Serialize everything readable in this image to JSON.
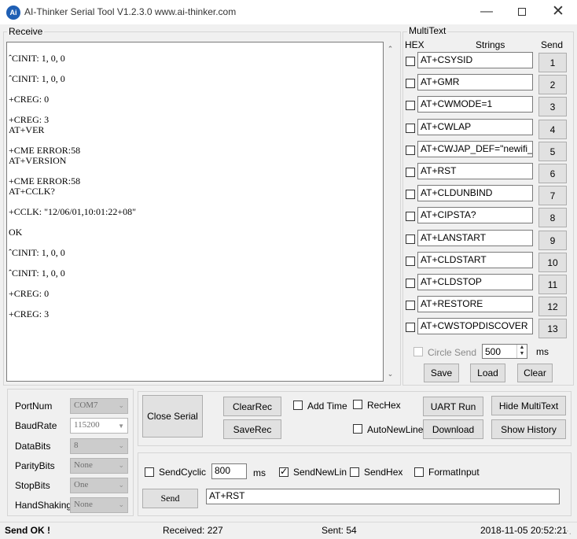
{
  "window": {
    "title": "AI-Thinker Serial Tool V1.2.3.0    www.ai-thinker.com",
    "icon_text": "Ai"
  },
  "receive": {
    "label": "Receive",
    "lines": "ˆCINIT: 1, 0, 0\n\nˆCINIT: 1, 0, 0\n\n+CREG: 0\n\n+CREG: 3\nAT+VER\n\n+CME ERROR:58\nAT+VERSION\n\n+CME ERROR:58\nAT+CCLK?\n\n+CCLK: \"12/06/01,10:01:22+08\"\n\nOK\n\nˆCINIT: 1, 0, 0\n\nˆCINIT: 1, 0, 0\n\n+CREG: 0\n\n+CREG: 3"
  },
  "multitext": {
    "label": "MultiText",
    "hdr_hex": "HEX",
    "hdr_strings": "Strings",
    "hdr_send": "Send",
    "rows": [
      {
        "text": "AT+CSYSID",
        "btn": "1"
      },
      {
        "text": "AT+GMR",
        "btn": "2"
      },
      {
        "text": "AT+CWMODE=1",
        "btn": "3"
      },
      {
        "text": "AT+CWLAP",
        "btn": "4"
      },
      {
        "text": "AT+CWJAP_DEF=\"newifi_",
        "btn": "5"
      },
      {
        "text": "AT+RST",
        "btn": "6"
      },
      {
        "text": "AT+CLDUNBIND",
        "btn": "7"
      },
      {
        "text": "AT+CIPSTA?",
        "btn": "8"
      },
      {
        "text": "AT+LANSTART",
        "btn": "9"
      },
      {
        "text": "AT+CLDSTART",
        "btn": "10"
      },
      {
        "text": "AT+CLDSTOP",
        "btn": "11"
      },
      {
        "text": "AT+RESTORE",
        "btn": "12"
      },
      {
        "text": "AT+CWSTOPDISCOVER",
        "btn": "13"
      }
    ],
    "circle_send_label": "Circle Send",
    "circle_value": "500",
    "circle_unit": "ms",
    "save": "Save",
    "load": "Load",
    "clear": "Clear"
  },
  "port": {
    "portnum_label": "PortNum",
    "portnum": "COM7",
    "baud_label": "BaudRate",
    "baud": "115200",
    "databits_label": "DataBits",
    "databits": "8",
    "parity_label": "ParityBits",
    "parity": "None",
    "stopbits_label": "StopBits",
    "stopbits": "One",
    "handshaking_label": "HandShaking",
    "handshaking": "None"
  },
  "controls": {
    "close_serial": "Close Serial",
    "clear_rec": "ClearRec",
    "save_rec": "SaveRec",
    "add_time": "Add Time",
    "rec_hex": "RecHex",
    "auto_newline": "AutoNewLine",
    "uart_run": "UART Run",
    "download": "Download",
    "hide_multitext": "Hide MultiText",
    "show_history": "Show History"
  },
  "sendpanel": {
    "send_cyclic": "SendCyclic",
    "cyclic_value": "800",
    "cyclic_unit": "ms",
    "send_newline": "SendNewLin",
    "send_hex": "SendHex",
    "format_input": "FormatInput",
    "send_button": "Send",
    "send_text": "AT+RST"
  },
  "status": {
    "state": "Send OK !",
    "received": "Received: 227",
    "sent": "Sent: 54",
    "datetime": "2018-11-05 20:52:21"
  }
}
